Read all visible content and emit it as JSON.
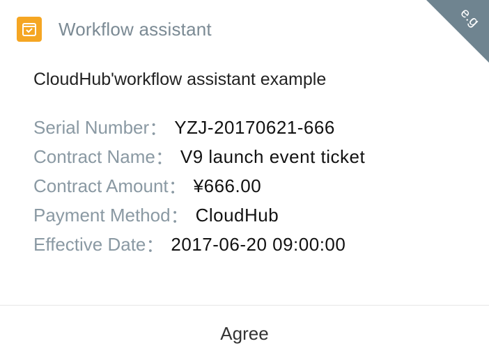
{
  "header": {
    "title": "Workflow assistant",
    "icon": "approval-form-icon",
    "icon_color": "#f5a623"
  },
  "corner_badge": {
    "label": "e.g",
    "color": "#6f8490"
  },
  "subtitle": "CloudHub'workflow assistant example",
  "fields": [
    {
      "label": "Serial Number",
      "colon": "：",
      "value": "YZJ-20170621-666"
    },
    {
      "label": "Contract Name",
      "colon": "：",
      "value": "V9 launch event ticket"
    },
    {
      "label": "Contract Amount",
      "colon": "：",
      "value": "¥666.00"
    },
    {
      "label": "Payment Method",
      "colon": "：",
      "value": "CloudHub"
    },
    {
      "label": "Effective Date",
      "colon": "：",
      "value": "2017-06-20 09:00:00"
    }
  ],
  "actions": {
    "agree_label": "Agree"
  }
}
